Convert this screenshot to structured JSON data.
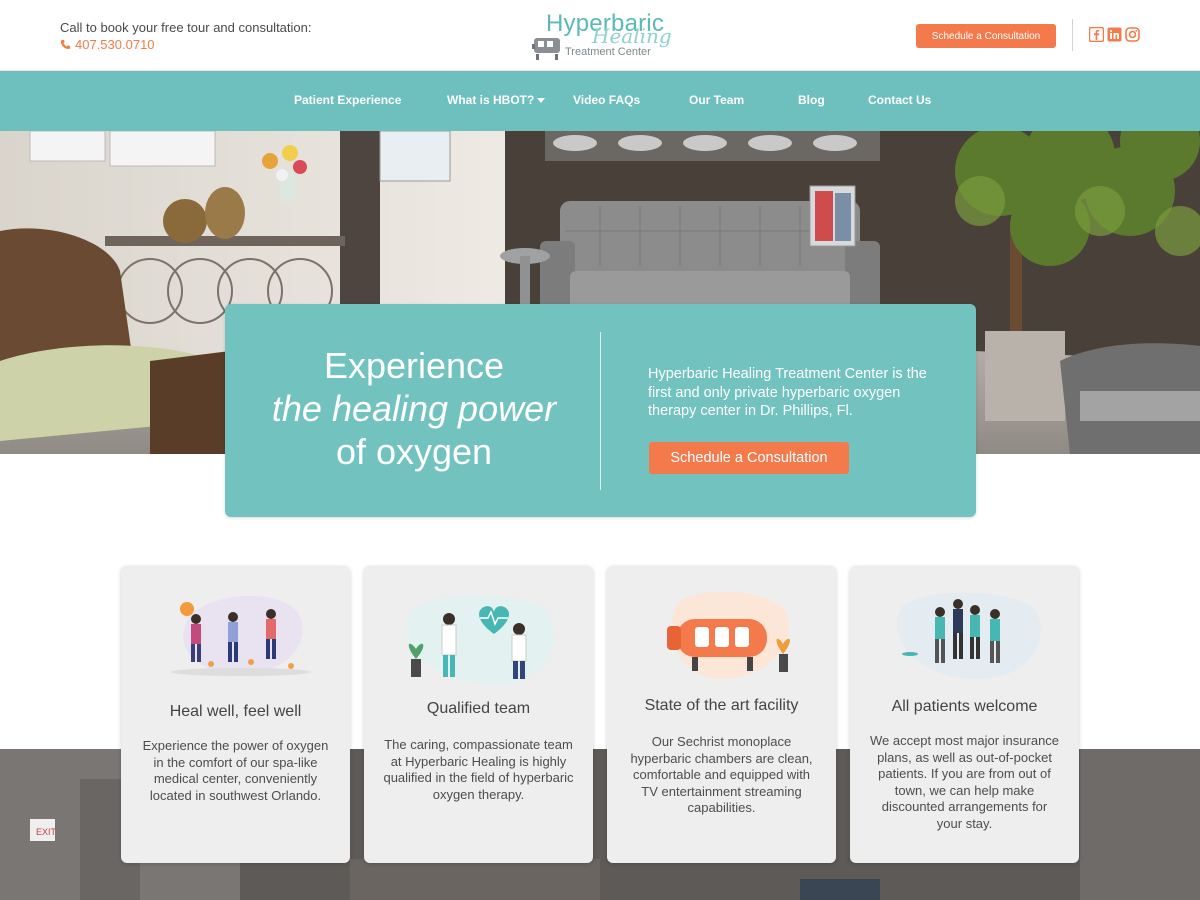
{
  "header": {
    "call_text": "Call to book your free tour and consultation:",
    "phone": "407.530.0710",
    "logo": {
      "line1": "Hyperbaric",
      "line2": "Healing",
      "line3": "Treatment Center"
    },
    "cta": "Schedule a Consultation",
    "social": [
      "facebook-icon",
      "linkedin-icon",
      "instagram-icon"
    ]
  },
  "nav": {
    "items": [
      {
        "label": "Patient Experience"
      },
      {
        "label": "What is HBOT?"
      },
      {
        "label": "Video FAQs"
      },
      {
        "label": "Our Team"
      },
      {
        "label": "Blog"
      },
      {
        "label": "Contact Us"
      }
    ]
  },
  "hero": {
    "title_line1": "Experience",
    "title_line2": "the healing power",
    "title_line3": "of oxygen",
    "description": "Hyperbaric Healing Treatment Center is the first and only private hyperbaric oxygen therapy center in Dr. Phillips, Fl.",
    "cta": "Schedule a Consultation"
  },
  "cards": [
    {
      "title": "Heal well, feel well",
      "text": "Experience the power of oxygen in the comfort of our spa-like medical center, conveniently located in southwest Orlando."
    },
    {
      "title": "Qualified team",
      "text": "The caring, compassionate team at Hyperbaric Healing is highly qualified in the field of hyperbaric oxygen therapy."
    },
    {
      "title": "State of the art facility",
      "text": "Our Sechrist monoplace hyperbaric chambers are clean, comfortable and equipped with TV entertainment streaming capabilities."
    },
    {
      "title": "All patients welcome",
      "text": "We accept most major insurance plans, as well as out-of-pocket patients. If you are from out of town, we can help make discounted arrangements for your stay."
    }
  ],
  "colors": {
    "teal": "#6dc0bd",
    "orange": "#f47a4c",
    "card_bg": "#eeeeee"
  }
}
